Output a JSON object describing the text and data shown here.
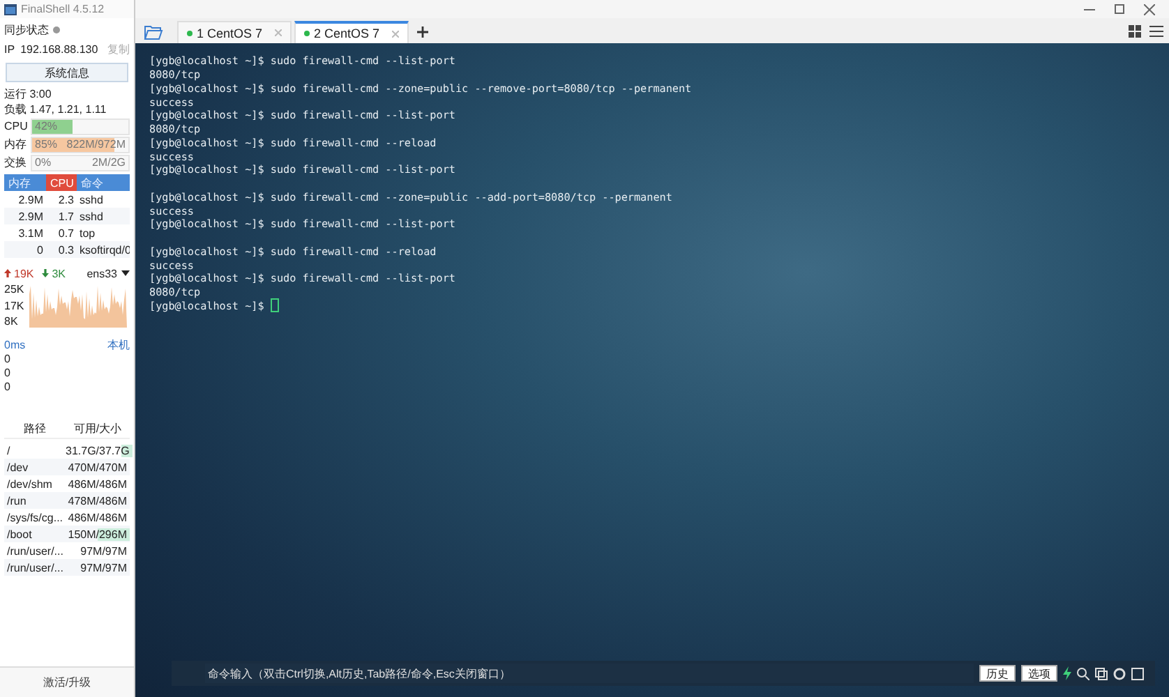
{
  "window": {
    "title": "FinalShell 4.5.12"
  },
  "sidebar": {
    "sync_status": "同步状态",
    "ip_label": "IP",
    "ip": "192.168.88.130",
    "copy": "复制",
    "system_info_button": "系统信息",
    "uptime": "运行 3:00",
    "load": "负载 1.47, 1.21, 1.11",
    "meters": [
      {
        "label": "CPU",
        "level": 0.42,
        "reading": "42%",
        "color": "#8fd08f"
      },
      {
        "label": "内存",
        "level": 0.85,
        "reading": "85%",
        "detail": "822M/972M",
        "color": "#f6c7a0"
      },
      {
        "label": "交换",
        "reading": "0%",
        "detail": "2M/2G"
      }
    ],
    "process_columns": [
      {
        "label": "内存",
        "selected": false
      },
      {
        "label": "CPU",
        "selected": true
      },
      {
        "label": "命令",
        "selected": false
      }
    ],
    "processes": [
      {
        "memory": "2.9M",
        "cpu": "2.3",
        "command": "sshd"
      },
      {
        "memory": "2.9M",
        "cpu": "1.7",
        "command": "sshd"
      },
      {
        "memory": "3.1M",
        "cpu": "0.7",
        "command": "top"
      },
      {
        "memory": "0",
        "cpu": "0.3",
        "command": "ksoftirqd/0"
      }
    ],
    "network": {
      "up": "19K",
      "down": "3K",
      "interface": "ens33",
      "axis_labels": [
        "25K",
        "17K",
        "8K"
      ]
    },
    "latency": {
      "reading": "0ms",
      "host": "本机",
      "axis_labels": [
        "0",
        "0",
        "0"
      ]
    },
    "disk_columns": [
      "路径",
      "可用/大小"
    ],
    "disks": [
      {
        "path": "/",
        "usage": "31.7G/37.7G",
        "level": 0.16
      },
      {
        "path": "/dev",
        "usage": "470M/470M"
      },
      {
        "path": "/dev/shm",
        "usage": "486M/486M"
      },
      {
        "path": "/run",
        "usage": "478M/486M"
      },
      {
        "path": "/sys/fs/cg...",
        "usage": "486M/486M"
      },
      {
        "path": "/boot",
        "usage": "150M/296M",
        "level": 0.49
      },
      {
        "path": "/run/user/...",
        "usage": "97M/97M"
      },
      {
        "path": "/run/user/...",
        "usage": "97M/97M"
      }
    ],
    "activate_button": "激活/升级"
  },
  "tabs": [
    {
      "label": "1 CentOS 7",
      "selected": false
    },
    {
      "label": "2 CentOS 7",
      "selected": true
    }
  ],
  "terminal": {
    "lines": [
      {
        "kind": "prompt",
        "prompt": "[ygb@localhost ~]$",
        "command": "sudo firewall-cmd --list-port"
      },
      {
        "kind": "output",
        "text": "8080/tcp"
      },
      {
        "kind": "prompt",
        "prompt": "[ygb@localhost ~]$",
        "command": "sudo firewall-cmd --zone=public --remove-port=8080/tcp --permanent"
      },
      {
        "kind": "output",
        "text": "success"
      },
      {
        "kind": "prompt",
        "prompt": "[ygb@localhost ~]$",
        "command": "sudo firewall-cmd --list-port"
      },
      {
        "kind": "output",
        "text": "8080/tcp"
      },
      {
        "kind": "prompt",
        "prompt": "[ygb@localhost ~]$",
        "command": "sudo firewall-cmd --reload"
      },
      {
        "kind": "output",
        "text": "success"
      },
      {
        "kind": "prompt",
        "prompt": "[ygb@localhost ~]$",
        "command": "sudo firewall-cmd --list-port"
      },
      {
        "kind": "blank"
      },
      {
        "kind": "prompt",
        "prompt": "[ygb@localhost ~]$",
        "command": "sudo firewall-cmd --zone=public --add-port=8080/tcp --permanent"
      },
      {
        "kind": "output",
        "text": "success"
      },
      {
        "kind": "prompt",
        "prompt": "[ygb@localhost ~]$",
        "command": "sudo firewall-cmd --list-port"
      },
      {
        "kind": "blank"
      },
      {
        "kind": "prompt",
        "prompt": "[ygb@localhost ~]$",
        "command": "sudo firewall-cmd --reload"
      },
      {
        "kind": "output",
        "text": "success"
      },
      {
        "kind": "prompt",
        "prompt": "[ygb@localhost ~]$",
        "command": "sudo firewall-cmd --list-port"
      },
      {
        "kind": "output",
        "text": "8080/tcp"
      },
      {
        "kind": "prompt",
        "prompt": "[ygb@localhost ~]$",
        "cursor": true
      }
    ]
  },
  "command_bar": {
    "placeholder": "命令输入（双击Ctrl切换,Alt历史,Tab路径/命令,Esc关闭窗口）",
    "buttons": [
      "历史",
      "选项"
    ]
  }
}
